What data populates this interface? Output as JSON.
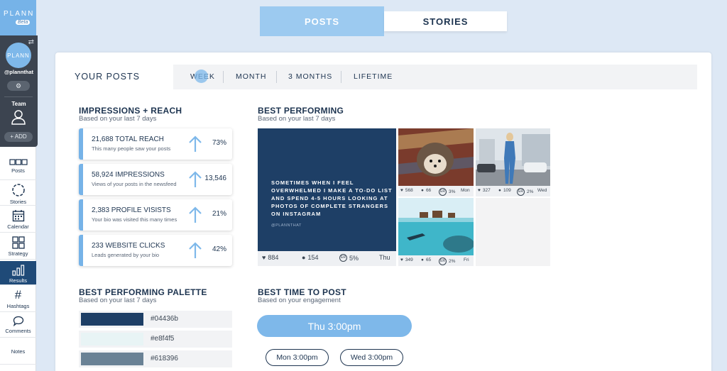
{
  "brand": {
    "logo": "PLANN",
    "badge": "Beta"
  },
  "profile": {
    "avatar_text": "PLANN",
    "handle": "@plannthat",
    "team_label": "Team",
    "add_label": "+ ADD"
  },
  "nav": [
    {
      "label": "Posts",
      "icon": "posts-grid-icon"
    },
    {
      "label": "Stories",
      "icon": "stories-circle-icon"
    },
    {
      "label": "Calendar",
      "icon": "calendar-icon"
    },
    {
      "label": "Strategy",
      "icon": "strategy-grid-icon"
    },
    {
      "label": "Results",
      "icon": "bar-chart-icon",
      "active": true
    },
    {
      "label": "Hashtags",
      "icon": "hashtag-icon"
    },
    {
      "label": "Comments",
      "icon": "comment-icon"
    },
    {
      "label": "Notes",
      "icon": ""
    }
  ],
  "top_tabs": {
    "posts": "POSTS",
    "stories": "STORIES"
  },
  "header": {
    "title": "YOUR POSTS"
  },
  "periods": [
    "WEEK",
    "MONTH",
    "3 MONTHS",
    "LIFETIME"
  ],
  "impressions": {
    "title": "IMPRESSIONS + REACH",
    "subtitle": "Based on your last 7 days",
    "metrics": [
      {
        "title": "21,688 TOTAL REACH",
        "desc": "This many people saw your posts",
        "value": "73%"
      },
      {
        "title": "58,924 IMPRESSIONS",
        "desc": "Views of your posts in the newsfeed",
        "value": "13,546"
      },
      {
        "title": "2,383 PROFILE VISISTS",
        "desc": "Your bio was visited this many times",
        "value": "21%"
      },
      {
        "title": "233 WEBSITE CLICKS",
        "desc": "Leads generated by your bio",
        "value": "42%"
      }
    ]
  },
  "best_performing": {
    "title": "BEST PERFORMING",
    "subtitle": "Based on your last 7 days",
    "feature": {
      "text": "SOMETIMES WHEN I FEEL OVERWHELMED I MAKE A TO-DO LIST AND SPEND 4-5 HOURS LOOKING AT PHOTOS OF COMPLETE STRANGERS ON INSTAGRAM",
      "handle": "@PLANNTHAT",
      "likes": "884",
      "comments": "154",
      "er_badge": "ER",
      "er": "5%",
      "day": "Thu"
    },
    "thumbs": [
      {
        "likes": "568",
        "comments": "66",
        "er": "3%",
        "day": "Mon"
      },
      {
        "likes": "327",
        "comments": "109",
        "er": "2%",
        "day": "Wed"
      },
      {
        "likes": "349",
        "comments": "65",
        "er": "2%",
        "day": "Fri"
      }
    ]
  },
  "palette": {
    "title": "BEST PERFORMING PALETTE",
    "subtitle": "Based on your last 7 days",
    "colors": [
      "#04436b",
      "#e8f4f5",
      "#618396"
    ]
  },
  "best_time": {
    "title": "BEST TIME TO POST",
    "subtitle": "Based on your engagement",
    "main": "Thu 3:00pm",
    "others": [
      "Mon 3:00pm",
      "Wed 3:00pm"
    ]
  },
  "colors": {
    "accent": "#76b3e8",
    "navy": "#1d3450",
    "active_nav": "#1f4a78"
  }
}
